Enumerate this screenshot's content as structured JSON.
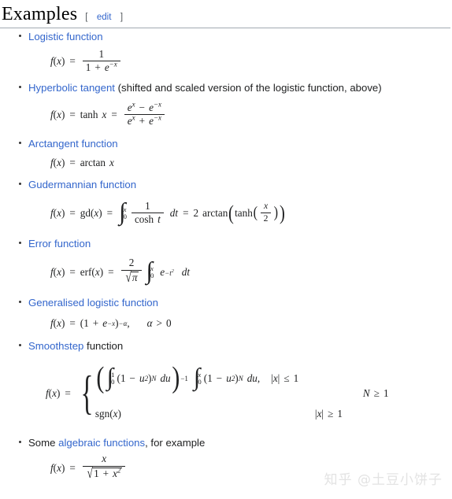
{
  "heading": {
    "title": "Examples",
    "edit_open_bracket": "[",
    "edit_label": "edit",
    "edit_close_bracket": "]"
  },
  "items": [
    {
      "link_text": "Logistic function",
      "plain_text": "",
      "formula_latex": "f(x) = \\frac{1}{1+e^{-x}}",
      "formula_plain": "f(x) = 1 / (1 + e^{-x})"
    },
    {
      "link_text": "Hyperbolic tangent",
      "plain_text": " (shifted and scaled version of the logistic function, above)",
      "formula_latex": "f(x) = \\tanh x = \\frac{e^x - e^{-x}}{e^x + e^{-x}}",
      "formula_plain": "f(x) = tanh x = (e^x - e^-x)/(e^x + e^-x)"
    },
    {
      "link_text": "Arctangent function",
      "plain_text": "",
      "formula_latex": "f(x) = \\arctan x",
      "formula_plain": "f(x) = arctan x"
    },
    {
      "link_text": "Gudermannian function",
      "plain_text": "",
      "formula_latex": "f(x) = \\mathrm{gd}(x) = \\int_0^x \\frac{1}{\\cosh t}\\,dt = 2\\arctan\\left(\\tanh\\left(\\frac{x}{2}\\right)\\right)",
      "formula_plain": "f(x) = gd(x) = int_0^x 1/cosh t dt = 2 arctan(tanh(x/2))"
    },
    {
      "link_text": "Error function",
      "plain_text": "",
      "formula_latex": "f(x) = \\mathrm{erf}(x) = \\frac{2}{\\sqrt{\\pi}}\\int_0^x e^{-t^2}\\,dt",
      "formula_plain": "f(x) = erf(x) = 2/sqrt(pi) int_0^x e^{-t^2} dt"
    },
    {
      "link_text": "Generalised logistic function",
      "plain_text": "",
      "formula_latex": "f(x) = (1+e^{-x})^{-\\alpha},\\quad \\alpha > 0",
      "formula_plain": "f(x) = (1 + e^-x)^-alpha,  alpha > 0"
    },
    {
      "link_text": "Smoothstep",
      "plain_text": " function",
      "formula_latex": "f(x)=\\begin{cases}\\left(\\int_0^1 (1-u^2)^N du\\right)^{-1}\\int_0^x (1-u^2)^N du, & |x| \\le 1 \\\\ \\mathrm{sgn}(x) & |x| \\ge 1\\end{cases} \\quad N \\ge 1",
      "formula_plain": "piecewise smoothstep, N >= 1"
    },
    {
      "link_text": "algebraic functions",
      "plain_text": ", for example",
      "prefix_text": "Some ",
      "formula_latex": "f(x) = \\frac{x}{\\sqrt{1+x^2}}",
      "formula_plain": "f(x) = x / sqrt(1 + x^2)"
    }
  ],
  "math_symbols": {
    "f": "f",
    "x": "x",
    "u": "u",
    "t": "t",
    "N": "N",
    "alpha": "α",
    "pi": "π",
    "equals": "=",
    "plus": "+",
    "minus": "−",
    "one": "1",
    "two": "2",
    "zero": "0",
    "comma": ",",
    "le": "≤",
    "ge": "≥",
    "gt": ">",
    "abs": "|",
    "tanh": "tanh",
    "arctan": "arctan",
    "cosh": "cosh",
    "gd": "gd",
    "erf": "erf",
    "sgn": "sgn",
    "d": "d",
    "e": "e",
    "integral": "∫",
    "radical": "√",
    "lparen": "(",
    "rparen": ")",
    "lbrace": "{"
  },
  "watermark": "知乎 @土豆小饼子",
  "colors": {
    "link": "#3366cc",
    "text": "#202122",
    "rule": "#a2a9b1",
    "bracket": "#54595d",
    "watermark": "#e3e3e3"
  }
}
